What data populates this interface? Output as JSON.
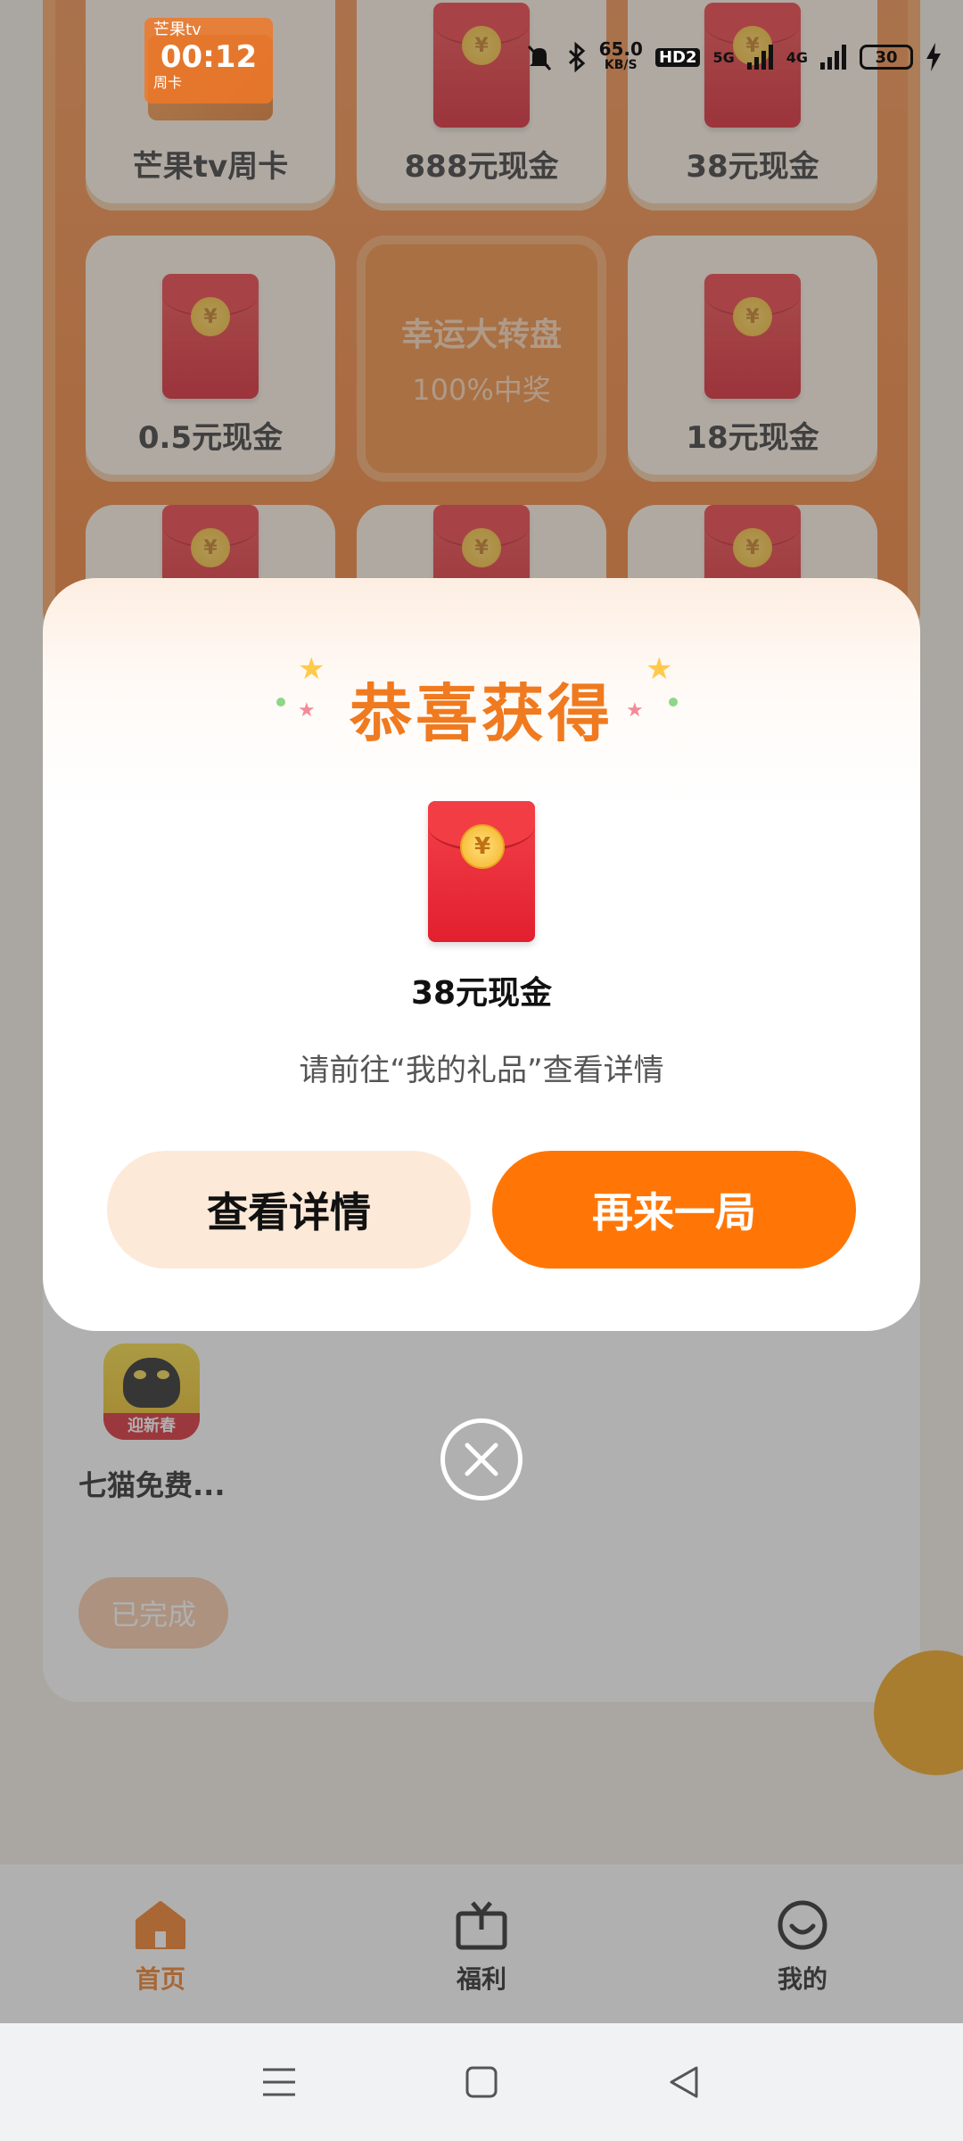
{
  "status_bar": {
    "time_badge_label": "芒果tv",
    "time": "00:12",
    "time_badge_sub": "周卡",
    "speed_value": "65.0",
    "speed_unit": "KB/S",
    "hd_label": "HD2",
    "net1": "5G",
    "net2": "4G",
    "battery": "30"
  },
  "wheel": {
    "cells": [
      {
        "label": "芒果tv周卡"
      },
      {
        "label": "888元现金"
      },
      {
        "label": "38元现金"
      },
      {
        "label": "0.5元现金"
      },
      {
        "label": "18元现金"
      }
    ],
    "center_line1": "幸运大转盘",
    "center_line2": "100%中奖"
  },
  "task": {
    "app_banner": "迎新春",
    "app_name": "七猫免费...",
    "done_label": "已完成"
  },
  "modal": {
    "title": "恭喜获得",
    "coin_symbol": "¥",
    "prize_name": "38元现金",
    "hint": "请前往“我的礼品”查看详情",
    "detail_button": "查看详情",
    "again_button": "再来一局"
  },
  "bottom_nav": {
    "items": [
      {
        "label": "首页",
        "icon": "home-icon",
        "active": true
      },
      {
        "label": "福利",
        "icon": "tv-icon",
        "active": false
      },
      {
        "label": "我的",
        "icon": "smile-icon",
        "active": false
      }
    ]
  },
  "colors": {
    "accent": "#ff7606",
    "title": "#f07a1f",
    "light_button": "#fde9d8"
  }
}
